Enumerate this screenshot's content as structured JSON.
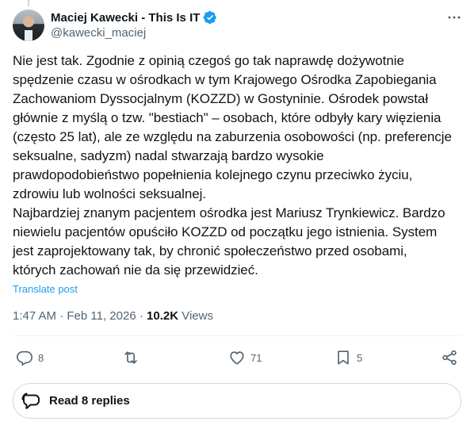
{
  "author": {
    "name": "Maciej Kawecki - This Is IT",
    "handle": "@kawecki_maciej",
    "verified": true,
    "verified_color": "#1d9bf0"
  },
  "post": {
    "text": "Nie jest tak. Zgodnie z opinią czegoś go tak naprawdę dożywotnie\nspędzenie czasu w ośrodkach w tym Krajowego Ośrodka Zapobiegania\nZachowaniom Dyssocjalnym (KOZZD) w Gostyninie. Ośrodek powstał\ngłównie z myślą o tzw. \"bestiach\" – osobach, które odbyły kary więzienia\n(często 25 lat), ale ze względu na zaburzenia osobowości (np. preferencje\nseksualne, sadyzm) nadal stwarzają bardzo wysokie\nprawdopodobieństwo popełnienia kolejnego czynu przeciwko życiu,\nzdrowiu lub wolności seksualnej.\nNajbardziej znanym pacjentem ośrodka jest Mariusz Trynkiewicz. Bardzo\nniewielu pacjentów opuściło KOZZD od początku jego istnienia. System\njest zaprojektowany tak, by chronić społeczeństwo przed osobami,\nktórych zachowań nie da się przewidzieć.",
    "translate_label": "Translate post",
    "time": "1:47 AM",
    "separator": "·",
    "date": "Feb 11, 2026",
    "views_count": "10.2K",
    "views_label": "Views"
  },
  "actions": {
    "replies": "8",
    "reposts": "",
    "likes": "71",
    "bookmarks": "5"
  },
  "read_replies_label": "Read 8 replies",
  "icons": {
    "more": "more-horizontal-icon",
    "reply": "reply-icon",
    "repost": "repost-icon",
    "like": "heart-icon",
    "bookmark": "bookmark-icon",
    "share": "share-icon",
    "replies": "speech-bubble-icon"
  }
}
